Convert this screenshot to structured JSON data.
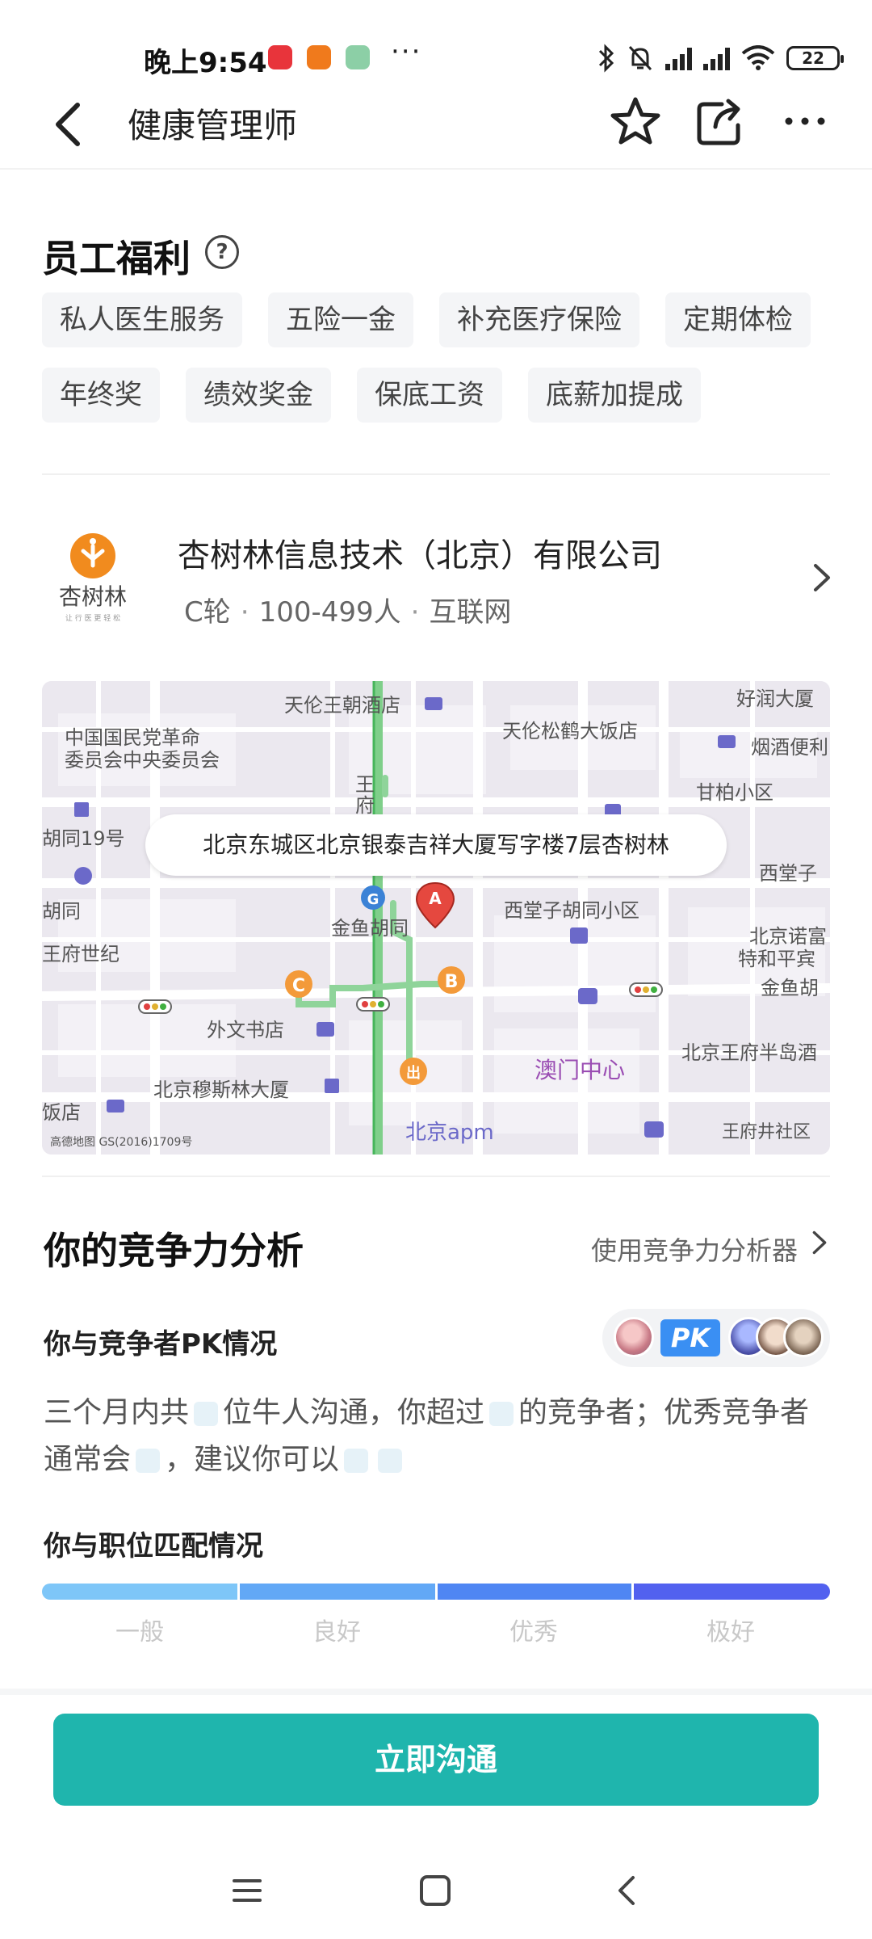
{
  "status_bar": {
    "time": "晚上9:54",
    "app_badges": [
      "小红书",
      "mi",
      "msg"
    ],
    "more": "···",
    "battery": "22"
  },
  "header": {
    "title": "健康管理师"
  },
  "benefits": {
    "title": "员工福利",
    "help": "?",
    "tags": [
      "私人医生服务",
      "五险一金",
      "补充医疗保险",
      "定期体检",
      "年终奖",
      "绩效奖金",
      "保底工资",
      "底薪加提成"
    ]
  },
  "company": {
    "logo_text": "杏树林",
    "logo_sub": "让 行 医 更 轻 松",
    "name": "杏树林信息技术（北京）有限公司",
    "funding": "C轮",
    "size": "100-499人",
    "industry": "互联网"
  },
  "map": {
    "address": "北京东城区北京银泰吉祥大厦写字楼7层杏树林",
    "provider": "高德地图 GS(2016)1709号",
    "labels": [
      "天伦王朝酒店",
      "好润大厦",
      "中国国民党革命",
      "委员会中央委员会",
      "天伦松鹤大饭店",
      "烟酒便利",
      "甘柏小区",
      "胡同19号",
      "胡同",
      "王府世纪",
      "金鱼胡同",
      "西堂子胡同小区",
      "西堂子",
      "北京诺富",
      "特和平宾",
      "金鱼胡",
      "外文书店",
      "澳门中心",
      "北京王府半岛酒",
      "北京穆斯林大厦",
      "饭店",
      "北京apm",
      "王府井社区",
      "王",
      "府"
    ]
  },
  "competition": {
    "title": "你的竞争力分析",
    "link": "使用竞争力分析器",
    "pk_title": "你与竞争者PK情况",
    "pk_badge": "PK",
    "text_1": "三个月内共",
    "text_2": "位牛人沟通，你超过",
    "text_3": "的竞争者；优秀竞争者",
    "text_4": "通常会",
    "text_5": "，建议你可以",
    "match_title": "你与职位匹配情况",
    "levels": [
      "一般",
      "良好",
      "优秀",
      "极好"
    ],
    "colors": [
      "#7ec6f8",
      "#62a8f6",
      "#4f86f3",
      "#5261ef"
    ]
  },
  "cta": {
    "label": "立即沟通",
    "color": "#1fb5ad"
  }
}
